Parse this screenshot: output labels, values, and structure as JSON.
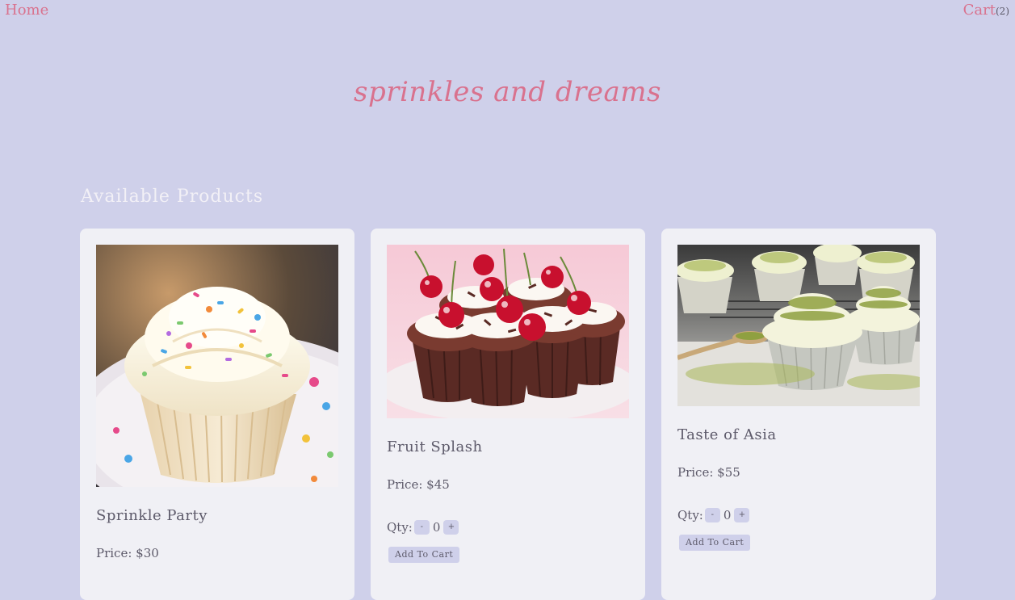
{
  "nav": {
    "home_label": "Home",
    "cart_label": "Cart",
    "cart_count": "(2)"
  },
  "brand": {
    "title": "sprinkles and dreams"
  },
  "section": {
    "title": "Available Products"
  },
  "products": [
    {
      "name": "Sprinkle Party",
      "price": "Price: $30",
      "image": "vanilla-sprinkle-cupcake"
    },
    {
      "name": "Fruit Splash",
      "price": "Price: $45",
      "qty_label": "Qty:",
      "qty_value": "0",
      "minus_label": "-",
      "plus_label": "+",
      "add_label": "Add To Cart",
      "image": "chocolate-cherry-cupcakes"
    },
    {
      "name": "Taste of Asia",
      "price": "Price: $55",
      "qty_label": "Qty:",
      "qty_value": "0",
      "minus_label": "-",
      "plus_label": "+",
      "add_label": "Add To Cart",
      "image": "matcha-cupcakes"
    }
  ],
  "colors": {
    "background": "#cfd0ea",
    "accent": "#d9728e",
    "card": "#f0f0f5",
    "text": "#5d5a6a"
  }
}
